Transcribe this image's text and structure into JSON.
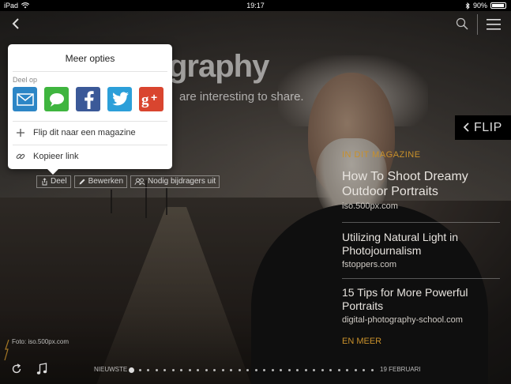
{
  "status_bar": {
    "device": "iPad",
    "time": "19:17",
    "battery": "90%"
  },
  "headline": {
    "title": "graphy",
    "subtitle": "are interesting to share."
  },
  "flip_button": {
    "label": "FLIP"
  },
  "magazine": {
    "label": "IN DIT MAGAZINE",
    "articles": [
      {
        "title": "How To Shoot Dreamy Outdoor Portraits",
        "source": "iso.500px.com"
      },
      {
        "title": "Utilizing Natural Light in Photojournalism",
        "source": "fstoppers.com"
      },
      {
        "title": "15 Tips for More Powerful Portraits",
        "source": "digital-photography-school.com"
      }
    ],
    "more": "EN MEER"
  },
  "actions": {
    "share": "Deel",
    "edit": "Bewerken",
    "invite": "Nodig bijdragers uit"
  },
  "popover": {
    "title": "Meer opties",
    "share_label": "Deel op",
    "share_targets": [
      "mail-icon",
      "messages-icon",
      "facebook-icon",
      "twitter-icon",
      "google-plus-icon"
    ],
    "flip_item": "Flip dit naar een magazine",
    "copy_item": "Kopieer link"
  },
  "photo_credit": "Foto: iso.500px.com",
  "pager": {
    "left_label": "NIEUWSTE",
    "right_label": "19 FEBRUARI",
    "dot_count": 30,
    "active_index": 0
  },
  "colors": {
    "accent": "#c8902b",
    "mail": "#2d86c6",
    "messages": "#3fb53f",
    "facebook": "#3b5998",
    "twitter": "#2c9fd9",
    "google_plus": "#d9452f"
  }
}
